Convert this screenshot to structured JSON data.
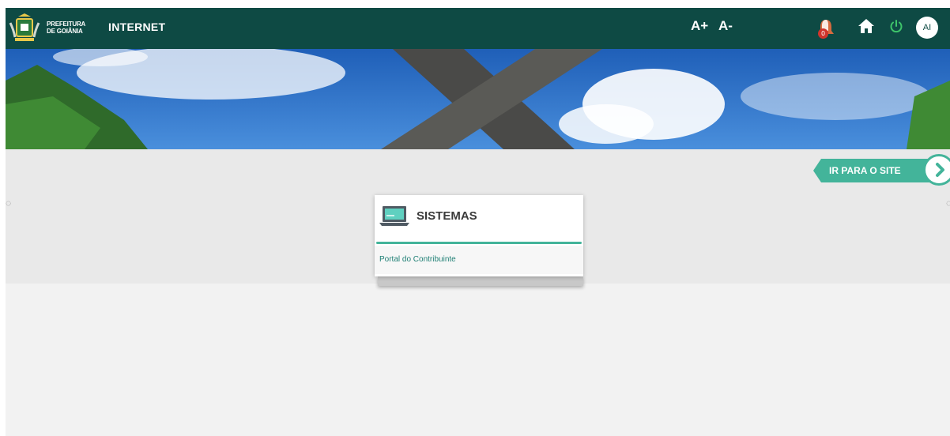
{
  "header": {
    "logo_line1": "PREFEITURA",
    "logo_line2": "DE GOIÂNIA",
    "title": "INTERNET",
    "font_increase": "A+",
    "font_decrease": "A-",
    "notification_count": "0",
    "avatar_initials": "AI"
  },
  "cta": {
    "label": "IR PARA O SITE"
  },
  "card": {
    "title": "SISTEMAS",
    "links": [
      "Portal do Contribuinte"
    ]
  },
  "carousel": {
    "prev": "◌",
    "next": "◌"
  },
  "colors": {
    "header_bg": "#0e4a44",
    "accent": "#43b49a",
    "link": "#1e7f74",
    "badge": "#d0342c"
  },
  "icons": [
    "logo-emblem",
    "bell-icon",
    "home-icon",
    "power-icon",
    "monitor-icon",
    "chevron-right-icon"
  ]
}
